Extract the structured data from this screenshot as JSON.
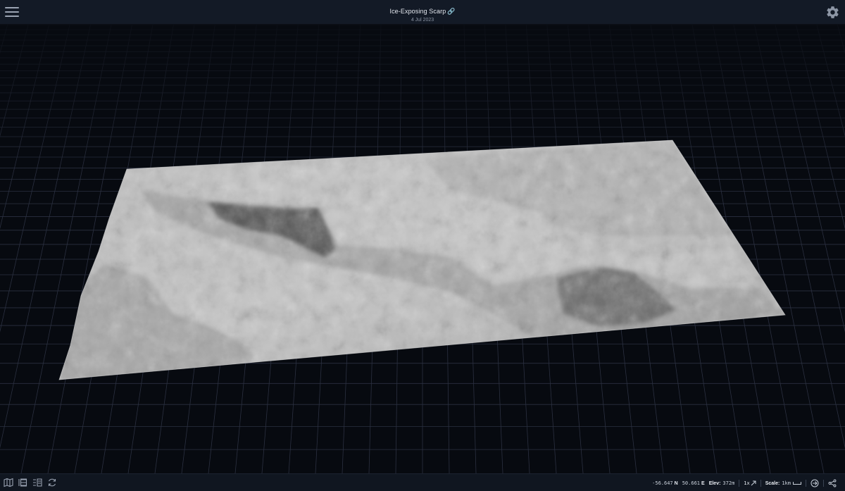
{
  "header": {
    "title": "Ice-Exposing Scarp",
    "link_icon": "link-icon",
    "date": "4 Jul 2023",
    "menu_icon": "hamburger-menu-icon",
    "settings_icon": "gear-icon"
  },
  "viewport": {
    "background": "#070a10",
    "grid_color": "#2b3040",
    "terrain_color": "#b3b3b3",
    "scarp_shadow_color": "#3a3a3a"
  },
  "bottom_toolbar": {
    "icons": [
      "map-icon",
      "layers-list-icon",
      "layers-settings-icon",
      "refresh-icon"
    ]
  },
  "status_bar": {
    "latitude": "-56.647",
    "lat_dir": "N",
    "longitude": "50.661",
    "lon_dir": "E",
    "elev_label": "Elev:",
    "elev_value": "372m",
    "zoom": "1x",
    "scale_label": "Scale:",
    "scale_value": "1km",
    "icons": [
      "vertical-exaggeration-icon",
      "enter-icon",
      "share-icon"
    ]
  }
}
